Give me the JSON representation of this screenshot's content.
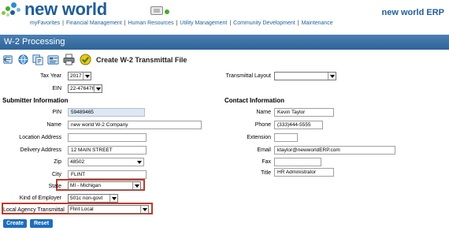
{
  "header": {
    "brand": "new world",
    "product_title": "new world ERP",
    "nav": [
      "myFavorites",
      "Financial Management",
      "Human Resources",
      "Utility Management",
      "Community Development",
      "Maintenance"
    ]
  },
  "page": {
    "title": "W-2 Processing"
  },
  "toolbar": {
    "title": "Create W-2 Transmittal File",
    "icons": [
      "first-icon",
      "previous-icon",
      "next-icon",
      "last-icon",
      "print-icon",
      "run-icon"
    ]
  },
  "form": {
    "tax_year": {
      "label": "Tax Year",
      "value": "2017"
    },
    "ein": {
      "label": "EIN",
      "value": "22-4764762"
    },
    "transmittal_layout": {
      "label": "Transmittal Layout",
      "value": ""
    },
    "submitter": {
      "heading": "Submitter Information",
      "pin": {
        "label": "PIN",
        "value": "59489465"
      },
      "name": {
        "label": "Name",
        "value": "new world W-2 Company"
      },
      "location_address": {
        "label": "Location Address",
        "value": ""
      },
      "delivery_address": {
        "label": "Delivery Address",
        "value": "12 MAIN STREET"
      },
      "zip": {
        "label": "Zip",
        "value": "48502"
      },
      "city": {
        "label": "City",
        "value": "FLINT"
      },
      "state": {
        "label": "State",
        "value": "MI - Michigan"
      },
      "kind_of_employer": {
        "label": "Kind of Employer",
        "value": "501c non-govt"
      },
      "local_agency_transmittal": {
        "label": "Local Agency Transmittal",
        "value": "Flint Local"
      }
    },
    "contact": {
      "heading": "Contact Information",
      "name": {
        "label": "Name",
        "value": "Kevin Taylor"
      },
      "phone": {
        "label": "Phone",
        "value": "(333)444-5555"
      },
      "extension": {
        "label": "Extension",
        "value": ""
      },
      "email": {
        "label": "Email",
        "value": "ktaylor@newworldERP.com"
      },
      "fax": {
        "label": "Fax",
        "value": ""
      },
      "title": {
        "label": "Title",
        "value": "HR Administrator"
      }
    }
  },
  "actions": {
    "create": "Create",
    "reset": "Reset"
  },
  "colors": {
    "brand_blue": "#1f5e99",
    "titlebar": "#2f6497",
    "highlight": "#c0392b",
    "button": "#1e6fbd"
  }
}
